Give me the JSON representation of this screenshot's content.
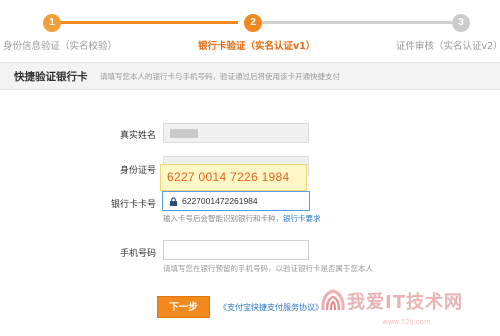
{
  "steps": [
    {
      "number": "1",
      "label": "身份信息验证（实名校验）",
      "state": "done"
    },
    {
      "number": "2",
      "label": "银行卡验证（实名认证v1）",
      "state": "active"
    },
    {
      "number": "3",
      "label": "证件审核（实名认证v2）",
      "state": "pending"
    }
  ],
  "colors": {
    "accent": "#f08a1e",
    "pending": "#cccccc",
    "link": "#2a78c9"
  },
  "panel": {
    "title": "快捷验证银行卡",
    "note": "请填写您本人的银行卡与手机号码，验证通过后将使用该卡开通快捷支付"
  },
  "form": {
    "name_label": "真实姓名",
    "id_label": "身份证号",
    "card_label": "银行卡卡号",
    "card_value": "6227001472261984",
    "card_tip": "6227 0014 7226 1984",
    "card_hint": "输入卡号后会智能识别银行和卡种，",
    "card_hint_link": "银行卡要求",
    "phone_label": "手机号码",
    "phone_hint": "请填写您在银行预留的手机号码，以验证银行卡是否属于您本人"
  },
  "actions": {
    "next_label": "下一步",
    "agreement_link": "《支付宝快捷支付服务协议》"
  },
  "watermark": {
    "text": "我爱IT技术网",
    "url": "www.52ij.com"
  }
}
